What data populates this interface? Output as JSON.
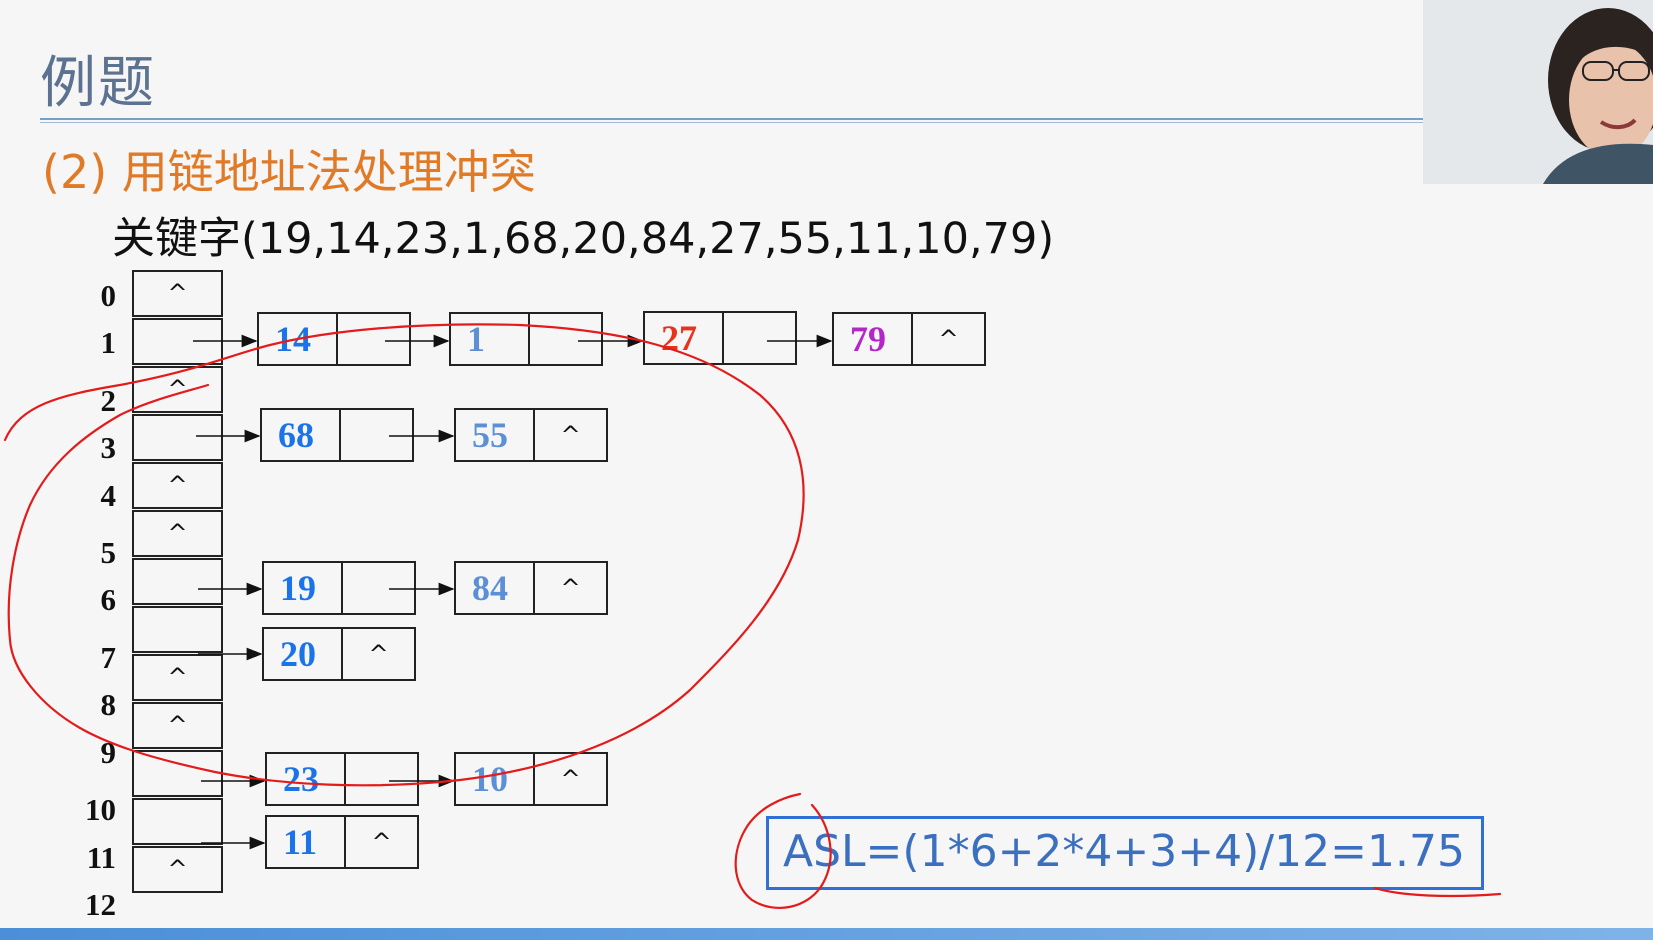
{
  "slide": {
    "title": "例题",
    "subtitle": "(2)  用链地址法处理冲突",
    "keys_label": "关键字(19,14,23,1,68,20,84,27,55,11,10,79)",
    "asl": "ASL=(1*6+2*4+3+4)/12=1.75"
  },
  "table": {
    "indices": [
      "0",
      "1",
      "2",
      "3",
      "4",
      "5",
      "6",
      "7",
      "8",
      "9",
      "10",
      "11",
      "12"
    ],
    "null_symbol": "^",
    "chains": {
      "1": [
        "14",
        "1",
        "27",
        "79"
      ],
      "3": [
        "68",
        "55"
      ],
      "6": [
        "19",
        "84"
      ],
      "7": [
        "20"
      ],
      "10": [
        "23",
        "10"
      ],
      "11": [
        "11"
      ]
    }
  },
  "colors": {
    "key_default": "#1a73e8",
    "key_light": "#5b8fd6",
    "key_red": "#e8321b",
    "key_purple": "#b526c9",
    "annotation": "#e31b1b",
    "title": "#5b7290",
    "subtitle": "#e07a26"
  },
  "icons": [
    "webcam-presenter-video",
    "hand-drawn-annotation"
  ]
}
